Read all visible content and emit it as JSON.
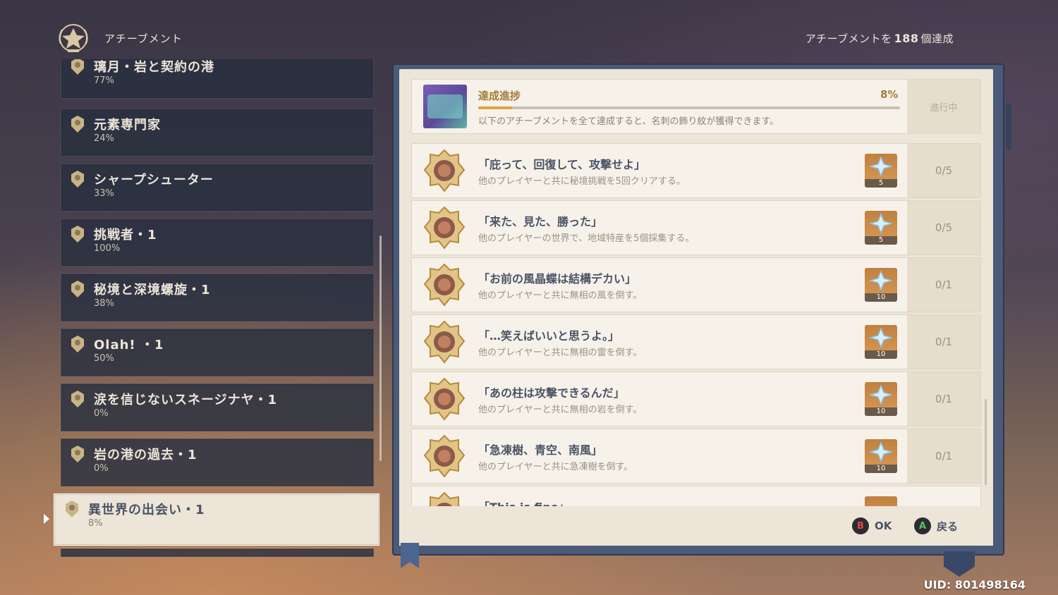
{
  "header": {
    "title": "アチーブメント",
    "count_prefix": "アチーブメントを",
    "count_value": "188",
    "count_suffix": "個達成"
  },
  "categories": [
    {
      "name": "璃月・岩と契約の港",
      "percent": "77%"
    },
    {
      "name": "元素専門家",
      "percent": "24%"
    },
    {
      "name": "シャープシューター",
      "percent": "33%"
    },
    {
      "name": "挑戦者・1",
      "percent": "100%"
    },
    {
      "name": "秘境と深境螺旋・1",
      "percent": "38%"
    },
    {
      "name": "Olah! ・1",
      "percent": "50%"
    },
    {
      "name": "涙を信じないスネージナヤ・1",
      "percent": "0%"
    },
    {
      "name": "岩の港の過去・1",
      "percent": "0%"
    },
    {
      "name": "異世界の出会い・1",
      "percent": "8%"
    }
  ],
  "progress": {
    "title": "達成進捗",
    "percent": "8%",
    "value": 0.08,
    "description": "以下のアチーブメントを全て達成すると、名刺の飾り紋が獲得できます。",
    "status": "進行中"
  },
  "achievements": [
    {
      "name": "「庇って、回復して、攻撃せよ」",
      "desc": "他のプレイヤーと共に秘境挑戦を5回クリアする。",
      "reward": "5",
      "progress": "0/5"
    },
    {
      "name": "「来た、見た、勝った」",
      "desc": "他のプレイヤーの世界で、地域特産を5個採集する。",
      "reward": "5",
      "progress": "0/5"
    },
    {
      "name": "「お前の風晶蝶は結構デカい」",
      "desc": "他のプレイヤーと共に無相の風を倒す。",
      "reward": "10",
      "progress": "0/1"
    },
    {
      "name": "「…笑えばいいと思うよ。」",
      "desc": "他のプレイヤーと共に無相の雷を倒す。",
      "reward": "10",
      "progress": "0/1"
    },
    {
      "name": "「あの柱は攻撃できるんだ」",
      "desc": "他のプレイヤーと共に無相の岩を倒す。",
      "reward": "10",
      "progress": "0/1"
    },
    {
      "name": "「急凍樹、青空、南風」",
      "desc": "他のプレイヤーと共に急凍樹を倒す。",
      "reward": "10",
      "progress": "0/1"
    },
    {
      "name": "「This is fine」",
      "desc": "",
      "reward": "",
      "progress": ""
    }
  ],
  "buttons": {
    "ok_glyph": "B",
    "ok_label": "OK",
    "back_glyph": "A",
    "back_label": "戻る"
  },
  "uid": "UID: 801498164",
  "colors": {
    "accent_gold": "#a57b3a",
    "progress_fill": "#e0a240",
    "page_bg": "#ece5d8",
    "button_b": "#e04848",
    "button_a": "#5cc068"
  }
}
